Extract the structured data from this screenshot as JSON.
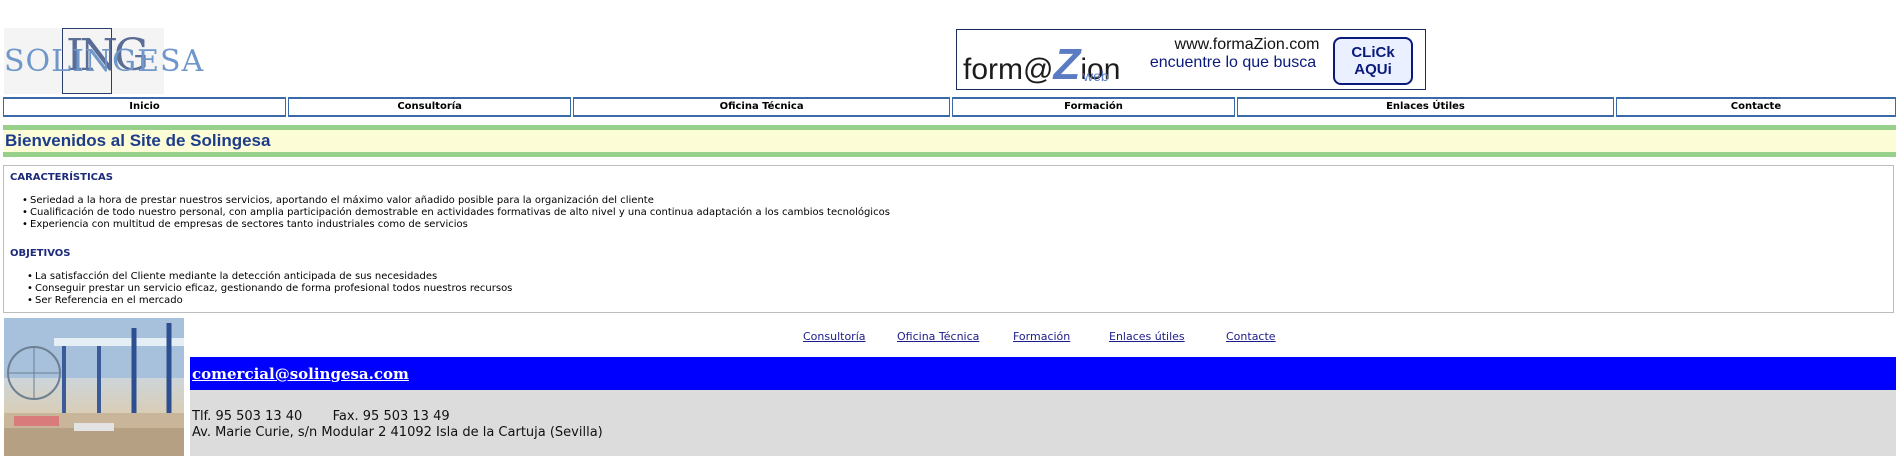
{
  "header": {
    "logo_text": "SOLINGESA",
    "logo_mono": "ING"
  },
  "banner": {
    "brand_left": "form@",
    "brand_z": "Z",
    "brand_right": "ion",
    "brand_sub": "web",
    "url": "www.formaZion.com",
    "tagline": "encuentre lo que busca",
    "cta_line1": "CLiCk",
    "cta_line2": "AQUi"
  },
  "nav": {
    "items": [
      "Inicio",
      "Consultoría",
      "Oficina Técnica",
      "Formación",
      "Enlaces Útiles",
      "Contacte"
    ]
  },
  "welcome": {
    "title": "Bienvenidos al Site de Solingesa"
  },
  "sections": {
    "caracteristicas": {
      "title": "CARACTERÍSTICAS",
      "items": [
        "Seriedad a la hora de prestar nuestros servicios, aportando el máximo valor añadido posible para la organización del cliente",
        "Cualificación de todo nuestro personal, con amplia participación demostrable en actividades formativas de alto nivel y una continua adaptación a los cambios tecnológicos",
        "Experiencia con multitud de empresas de sectores tanto industriales como de servicios"
      ]
    },
    "objetivos": {
      "title": "OBJETIVOS",
      "items": [
        "La satisfacción del Cliente mediante la detección anticipada de sus necesidades",
        "Conseguir prestar un servicio eficaz, gestionando de forma profesional todos nuestros recursos",
        "Ser Referencia en el mercado"
      ]
    }
  },
  "footer": {
    "links": [
      "Consultoría",
      "Oficina Técnica",
      "Formación",
      "Enlaces útiles",
      "Contacte"
    ],
    "email": "comercial@solingesa.com",
    "phone": "Tlf. 95 503 13 40",
    "fax": "Fax. 95 503 13 49",
    "address": "Av. Marie Curie, s/n Modular 2 41092 Isla de la Cartuja (Sevilla)"
  },
  "colors": {
    "nav_border": "#3b6aa8",
    "band_green": "#96d08a",
    "welcome_bg": "#fcfcd6",
    "title_blue": "#1d3d8a",
    "email_bar": "#0000ff",
    "contact_bg": "#dcdcdc"
  }
}
